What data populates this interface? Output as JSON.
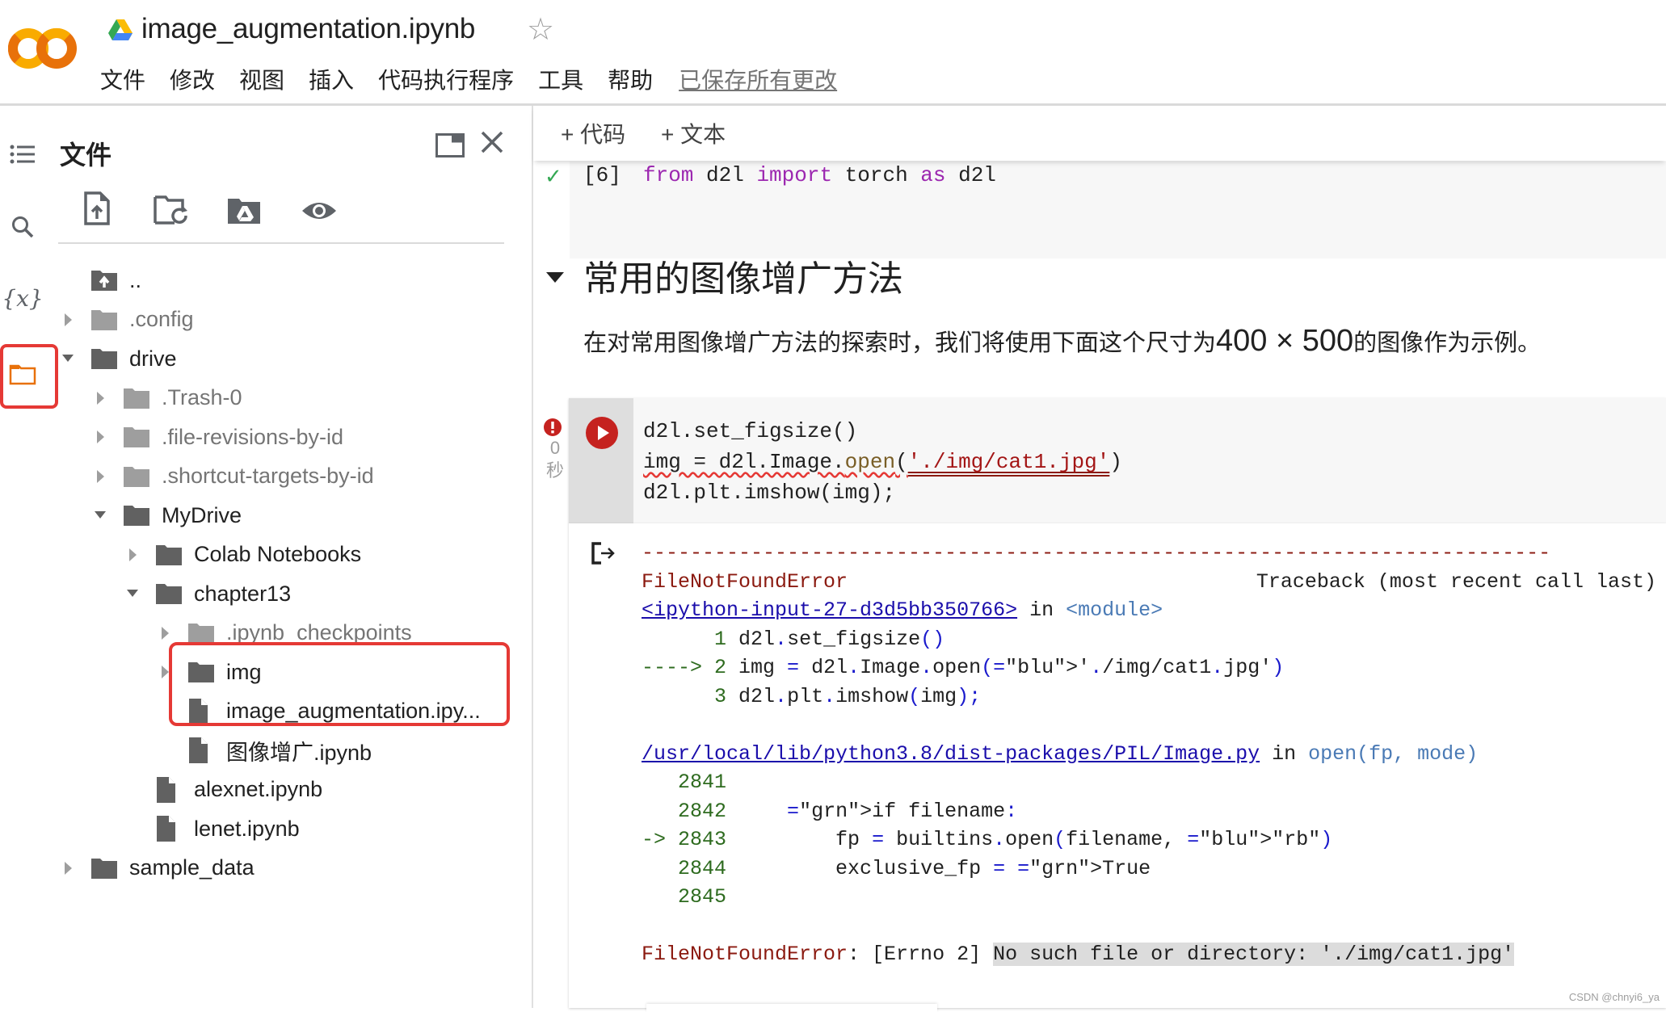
{
  "header": {
    "title": "image_augmentation.ipynb",
    "menu": [
      "文件",
      "修改",
      "视图",
      "插入",
      "代码执行程序",
      "工具",
      "帮助"
    ],
    "saved_status": "已保存所有更改"
  },
  "rail": {
    "items": [
      "table-of-contents",
      "search",
      "variables",
      "files"
    ]
  },
  "sidebar": {
    "title": "文件",
    "tree": [
      {
        "label": "..",
        "type": "parent-dir",
        "depth": 0,
        "expanded": null
      },
      {
        "label": ".config",
        "type": "folder-hidden",
        "depth": 0,
        "expanded": false
      },
      {
        "label": "drive",
        "type": "folder",
        "depth": 0,
        "expanded": true
      },
      {
        "label": ".Trash-0",
        "type": "folder-hidden",
        "depth": 1,
        "expanded": false
      },
      {
        "label": ".file-revisions-by-id",
        "type": "folder-hidden",
        "depth": 1,
        "expanded": false
      },
      {
        "label": ".shortcut-targets-by-id",
        "type": "folder-hidden",
        "depth": 1,
        "expanded": false
      },
      {
        "label": "MyDrive",
        "type": "folder",
        "depth": 1,
        "expanded": true
      },
      {
        "label": "Colab Notebooks",
        "type": "folder",
        "depth": 2,
        "expanded": false
      },
      {
        "label": "chapter13",
        "type": "folder",
        "depth": 2,
        "expanded": true
      },
      {
        "label": ".ipynb_checkpoints",
        "type": "folder-hidden",
        "depth": 3,
        "expanded": false
      },
      {
        "label": "img",
        "type": "folder",
        "depth": 3,
        "expanded": false
      },
      {
        "label": "image_augmentation.ipy...",
        "type": "file",
        "depth": 3,
        "expanded": null
      },
      {
        "label": "图像增广.ipynb",
        "type": "file",
        "depth": 3,
        "expanded": null
      },
      {
        "label": "alexnet.ipynb",
        "type": "file",
        "depth": 2,
        "expanded": null
      },
      {
        "label": "lenet.ipynb",
        "type": "file",
        "depth": 2,
        "expanded": null
      },
      {
        "label": "sample_data",
        "type": "folder",
        "depth": 0,
        "expanded": false
      }
    ]
  },
  "main": {
    "toolbar": {
      "add_code": "+ 代码",
      "add_text": "+ 文本"
    },
    "cell6": {
      "count": "[6]",
      "code": [
        {
          "t": "from",
          "c": "kw"
        },
        {
          "t": " d2l ",
          "c": ""
        },
        {
          "t": "import",
          "c": "kw"
        },
        {
          "t": " torch ",
          "c": ""
        },
        {
          "t": "as",
          "c": "kw"
        },
        {
          "t": " d2l",
          "c": ""
        }
      ]
    },
    "section_heading": "常用的图像增广方法",
    "paragraph_pre": "在对常用图像增广方法的探索时，我们将使用下面这个尺寸为",
    "paragraph_math": "400 × 500",
    "paragraph_post": "的图像作为示例。",
    "cell27": {
      "exec_time_value": "0",
      "exec_time_unit": "秒",
      "line1": "d2l.set_figsize()",
      "line2_a": "img = d2l.Image.",
      "line2_open": "open",
      "line2_b": "(",
      "line2_str": "'./img/cat1.jpg'",
      "line2_c": ")",
      "line3": "d2l.plt.imshow(img);"
    },
    "output": {
      "separator": "---------------------------------------------------------------------------",
      "error_name": "FileNotFoundError",
      "traceback_label": "Traceback (most recent call last)",
      "frame1_link": "<ipython-input-27-d3d5bb350766>",
      "frame1_in": " in ",
      "frame1_module": "<module>",
      "frame1_lines": [
        {
          "prefix": "      1",
          "code": " d2l.set_figsize()"
        },
        {
          "prefix": "----> 2",
          "code": " img = d2l.Image.open('./img/cat1.jpg')"
        },
        {
          "prefix": "      3",
          "code": " d2l.plt.imshow(img);"
        }
      ],
      "frame2_link": "/usr/local/lib/python3.8/dist-packages/PIL/Image.py",
      "frame2_in": " in ",
      "frame2_func": "open(fp, mode)",
      "frame2_lines": [
        {
          "prefix": "   2841",
          "code": ""
        },
        {
          "prefix": "   2842",
          "code": "     if filename:"
        },
        {
          "prefix": "-> 2843",
          "code": "         fp = builtins.open(filename, \"rb\")"
        },
        {
          "prefix": "   2844",
          "code": "         exclusive_fp = True"
        },
        {
          "prefix": "   2845",
          "code": ""
        }
      ],
      "final_error_name": "FileNotFoundError",
      "final_error_mid": ": [Errno 2] ",
      "final_error_msg": "No such file or directory: './img/cat1.jpg'"
    }
  },
  "watermark": "CSDN @chnyi6_ya",
  "colors": {
    "accent_orange": "#e8710a",
    "error_red": "#c5221f",
    "highlight_box": "#e53935",
    "success_green": "#34a853"
  }
}
